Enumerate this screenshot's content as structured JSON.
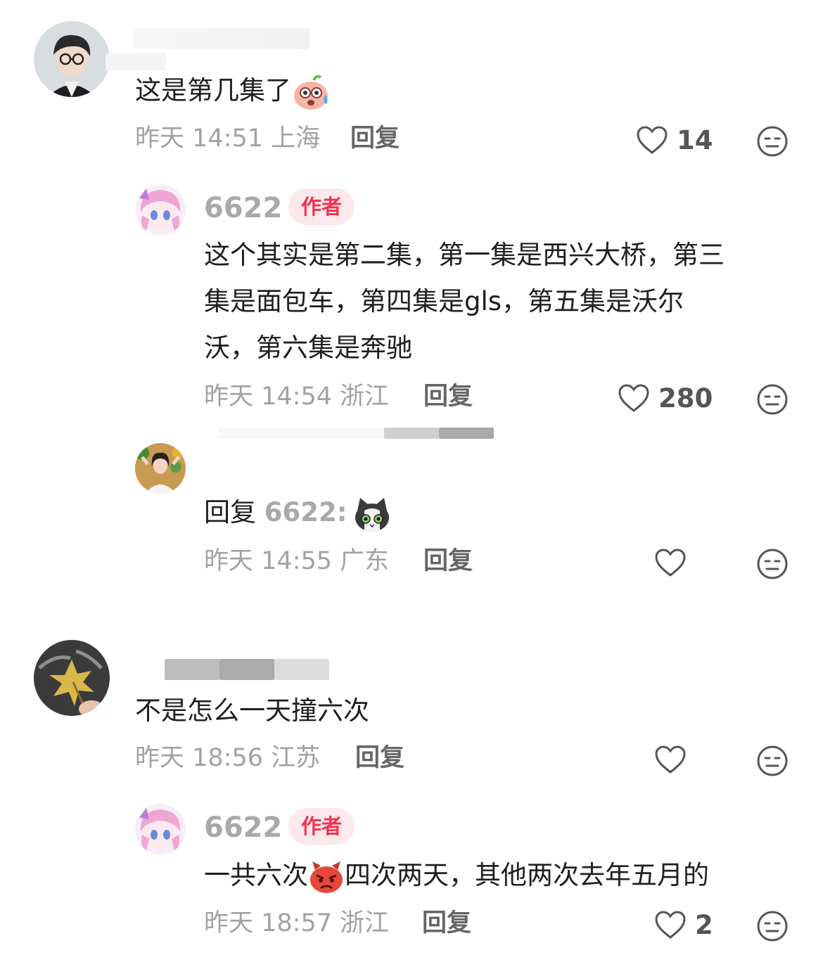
{
  "comments": [
    {
      "username": "",
      "text": "这是第几集了",
      "emoji": "sweat-face-emoji",
      "time": "昨天 14:51",
      "location": "上海",
      "reply_label": "回复",
      "likes": "14",
      "replies": [
        {
          "username": "6622",
          "badge": "作者",
          "text_lines": [
            "这个其实是第二集，第一集是西兴大桥，第三",
            "集是面包车，第四集是gls，第五集是沃尔",
            "沃，第六集是奔驰"
          ],
          "time": "昨天 14:54",
          "location": "浙江",
          "reply_label": "回复",
          "likes": "280"
        },
        {
          "username": "",
          "reply_prefix": "回复",
          "reply_to": "6622:",
          "emoji": "cat-emoji",
          "time": "昨天 14:55",
          "location": "广东",
          "reply_label": "回复",
          "likes": ""
        }
      ]
    },
    {
      "username": "",
      "text": "不是怎么一天撞六次",
      "time": "昨天 18:56",
      "location": "江苏",
      "reply_label": "回复",
      "likes": "",
      "replies": [
        {
          "username": "6622",
          "badge": "作者",
          "text_a": "一共六次",
          "emoji": "angry-face-emoji",
          "text_b": "四次两天，其他两次去年五月的",
          "time": "昨天 18:57",
          "location": "浙江",
          "reply_label": "回复",
          "likes": "2"
        }
      ]
    }
  ],
  "colors": {
    "author_badge_bg": "#fde8ec",
    "author_badge_text": "#f0334f",
    "meta": "#a2a2a2"
  }
}
